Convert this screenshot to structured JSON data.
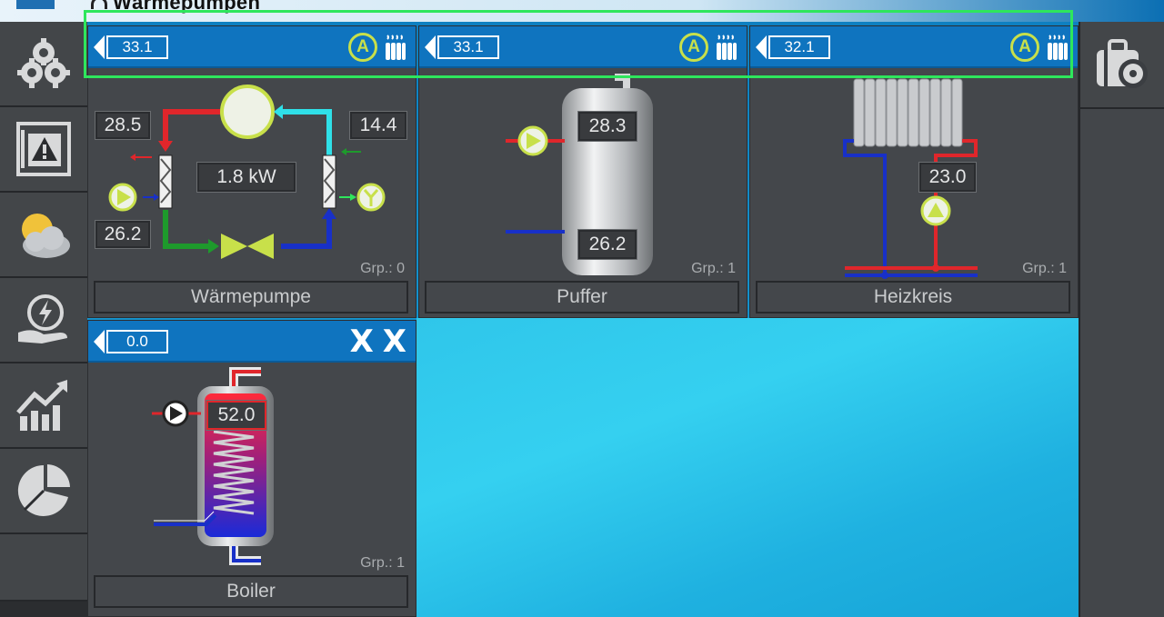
{
  "window": {
    "title": "Wärmepumpen"
  },
  "panels": {
    "waermepumpe": {
      "header_value": "33.1",
      "name": "Wärmepumpe",
      "group": "Grp.: 0",
      "temp_top_left": "28.5",
      "temp_top_right": "14.4",
      "temp_bottom_left": "26.2",
      "power": "1.8 kW"
    },
    "puffer": {
      "header_value": "33.1",
      "name": "Puffer",
      "group": "Grp.: 1",
      "temp_top": "28.3",
      "temp_bottom": "26.2"
    },
    "heizkreis": {
      "header_value": "32.1",
      "name": "Heizkreis",
      "group": "Grp.: 1",
      "temp_flow": "23.0"
    },
    "boiler": {
      "header_value": "0.0",
      "name": "Boiler",
      "group": "Grp.: 1",
      "temp": "52.0"
    }
  },
  "header_icons": {
    "auto_mode": "A",
    "close_glyph": "X"
  },
  "icons": {
    "settings": "gears-icon",
    "alarm": "warning-icon",
    "weather": "weather-icon",
    "energy": "energy-hand-icon",
    "statistics": "chart-icon",
    "pie": "pie-chart-icon",
    "service": "toolbox-settings-icon"
  },
  "colors": {
    "accent_blue": "#0f74bf",
    "highlight_green": "#2ee65c",
    "icon_green": "#c8e04a",
    "hot_red": "#e0262b",
    "cold_blue": "#1830c8",
    "water_cyan": "#2fc6ea"
  }
}
